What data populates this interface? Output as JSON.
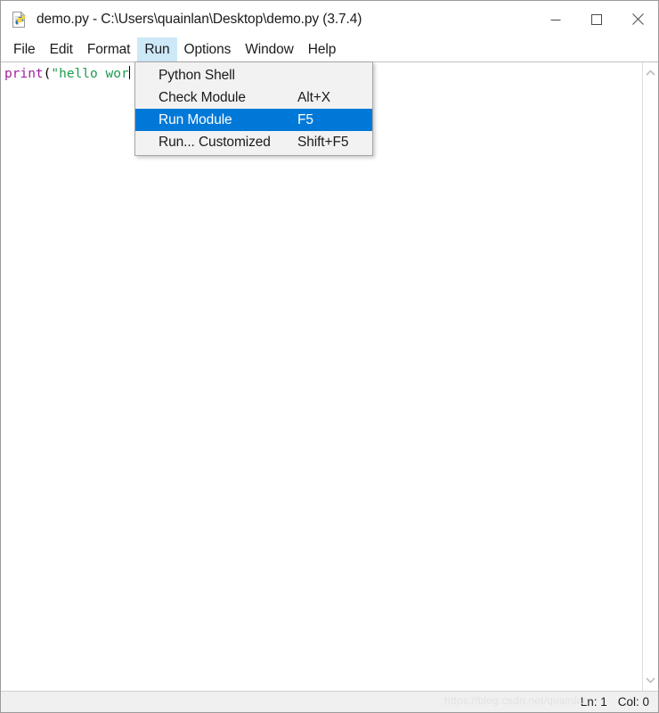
{
  "window": {
    "title": "demo.py - C:\\Users\\quainlan\\Desktop\\demo.py (3.7.4)",
    "icon": "python-file-icon",
    "controls": {
      "minimize_label": "Minimize",
      "maximize_label": "Maximize",
      "close_label": "Close"
    }
  },
  "menubar": {
    "items": [
      {
        "label": "File",
        "active": false
      },
      {
        "label": "Edit",
        "active": false
      },
      {
        "label": "Format",
        "active": false
      },
      {
        "label": "Run",
        "active": true
      },
      {
        "label": "Options",
        "active": false
      },
      {
        "label": "Window",
        "active": false
      },
      {
        "label": "Help",
        "active": false
      }
    ]
  },
  "run_menu": {
    "open": true,
    "highlight_color": "#0078d7",
    "items": [
      {
        "label": "Python Shell",
        "accelerator": "",
        "selected": false
      },
      {
        "label": "Check Module",
        "accelerator": "Alt+X",
        "selected": false
      },
      {
        "label": "Run Module",
        "accelerator": "F5",
        "selected": true
      },
      {
        "label": "Run... Customized",
        "accelerator": "Shift+F5",
        "selected": false
      }
    ]
  },
  "editor": {
    "code_tokens": [
      {
        "text": "print",
        "kind": "keyword"
      },
      {
        "text": "(",
        "kind": "punct"
      },
      {
        "text": "\"hello wor",
        "kind": "string"
      }
    ],
    "full_line": "print(\"hello wor",
    "colors": {
      "keyword": "#a020a0",
      "string": "#1e9b4e",
      "punct": "#000000",
      "background": "#ffffff"
    }
  },
  "scrollbar": {
    "up_arrow": "chevron-up-icon",
    "down_arrow": "chevron-down-icon"
  },
  "statusbar": {
    "line_label": "Ln: 1",
    "col_label": "Col: 0",
    "watermark": "https://blog.csdn.net/quainlan"
  }
}
